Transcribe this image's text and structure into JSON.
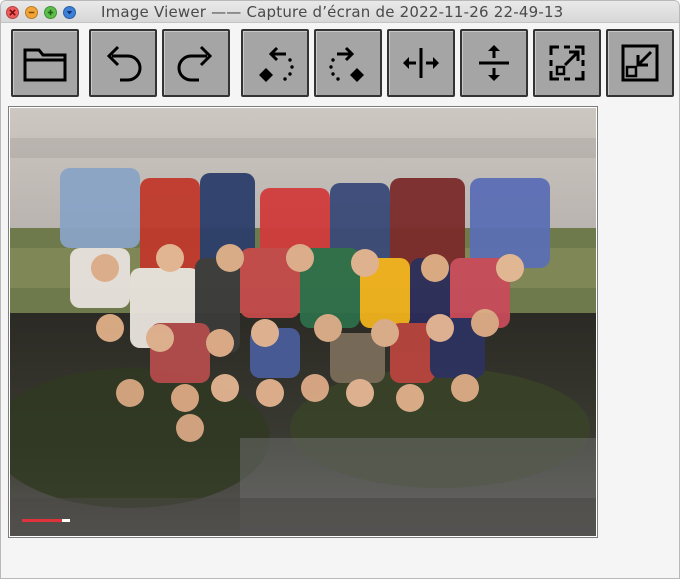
{
  "window": {
    "title": "Image Viewer —— Capture d’écran de 2022‑11‑26 22‑49‑13",
    "controls": [
      "close-icon",
      "minimize-icon",
      "maximize-icon",
      "menu-icon"
    ]
  },
  "toolbar": {
    "buttons": [
      {
        "icon": "folder-icon"
      },
      {
        "icon": "undo-icon"
      },
      {
        "icon": "redo-icon"
      },
      {
        "icon": "rotate-left-icon"
      },
      {
        "icon": "rotate-right-icon"
      },
      {
        "icon": "flip-horizontal-icon"
      },
      {
        "icon": "flip-vertical-icon"
      },
      {
        "icon": "fit-to-window-icon"
      },
      {
        "icon": "actual-size-icon"
      }
    ]
  },
  "image": {
    "description_visible": "upside-down group photograph of children outdoors"
  },
  "colors": {
    "button_face": "#a5a5a5",
    "button_border": "#333333",
    "close": "#f05b5b",
    "minimize": "#f2a536",
    "maximize": "#5cbf4a",
    "menu": "#3c7fd6"
  }
}
